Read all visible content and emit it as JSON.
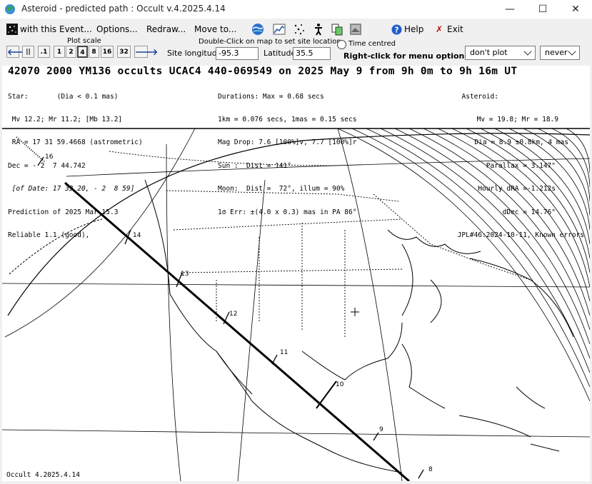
{
  "window": {
    "title": "Asteroid - predicted path : Occult v.4.2025.4.14",
    "minimize": "—",
    "maximize": "☐",
    "close": "✕"
  },
  "menu": {
    "event": "with this Event...",
    "options": "Options...",
    "redraw": "Redraw...",
    "move": "Move to...",
    "help": "Help",
    "exit": "Exit"
  },
  "toolbar_icons": [
    "globe-icon",
    "chart-icon",
    "stars-icon",
    "figure-icon",
    "copy-icon",
    "image-icon"
  ],
  "plot_scale": {
    "label": "Plot scale",
    "buttons": [
      ".1",
      "1",
      "2",
      "4",
      "8",
      "16",
      "32"
    ],
    "selected": "4"
  },
  "site": {
    "hint": "Double-Click on map to set site location",
    "lon_label": "Site longitude",
    "lon_value": "-95.3",
    "lat_label": "Latitude",
    "lat_value": "35.5",
    "time_centred": "Time centred",
    "right_click": "Right-click for menu options"
  },
  "dropdowns": {
    "plot": "don't plot",
    "never": "never"
  },
  "header": {
    "headline": "42070 2000 YM136 occults UCAC4 440-069549 on 2025 May  9 from  9h  0m to  9h 16m UT"
  },
  "star_block": [
    "Star:       (Dia < 0.1 mas)",
    " Mv 12.2; Mr 11.2; [Mb 13.2]",
    " RA = 17 31 59.4668 (astrometric)",
    "Dec = - 2  7 44.742",
    " [of Date: 17 33 20, - 2  8 59]",
    "Prediction of 2025 Mar 15.3",
    "Reliable 1.1 (good),"
  ],
  "duration_block": [
    "Durations: Max = 0.68 secs",
    "1km = 0.076 secs, 1mas = 0.15 secs",
    "Mag Drop: 7.6 [100%]v, 7.7 [100%]r",
    "Sun :  Dist = 141°",
    "Moon:  Dist =  72°, illum = 90%",
    "1σ Err: ±(4.0 x 0.3) mas in PA 86°"
  ],
  "asteroid_block": [
    "Asteroid:",
    "Mv = 19.8; Mr = 18.9",
    "Dia = 8.9 ±0.8km, 4 mas",
    "Parallax = 3.147\"",
    "Hourly dRA =-1.212s",
    "dDec = 14.76\"",
    "JPL#46:2024-10-11, Known errors"
  ],
  "path_hours": [
    "16",
    "14",
    "13",
    "12",
    "11",
    "10",
    "9",
    "8"
  ],
  "footer": "Occult 4.2025.4.14"
}
